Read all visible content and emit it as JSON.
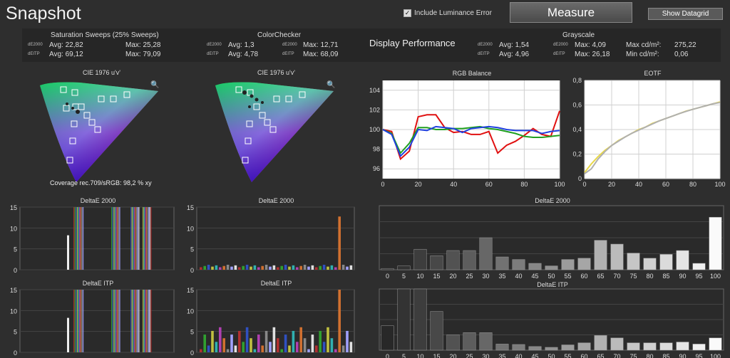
{
  "header": {
    "title": "Snapshot",
    "lum_label": "Include Luminance Error",
    "measure_label": "Measure",
    "datagrid_label": "Show Datagrid"
  },
  "stats": {
    "sat": {
      "title": "Saturation Sweeps (25% Sweeps)",
      "l1": "dE2000",
      "l2": "dEITP",
      "avg1": "Avg: 22,82",
      "max1": "Max: 25,28",
      "avg2": "Avg: 69,12",
      "max2": "Max: 79,09"
    },
    "cc": {
      "title": "ColorChecker",
      "l1": "dE2000",
      "l2": "dEITP",
      "avg1": "Avg: 1,3",
      "max1": "Max: 12,71",
      "avg2": "Avg: 4,78",
      "max2": "Max: 68,09"
    },
    "dp": "Display Performance",
    "gs": {
      "title": "Grayscale",
      "l1": "dE2000",
      "l2": "dEITP",
      "avg1": "Avg: 1,54",
      "max1": "Max: 4,09",
      "avg2": "Avg: 4,96",
      "max2": "Max: 26,18",
      "cdmax_label": "Max cd/m²:",
      "cdmax": "275,22",
      "cdmin_label": "Min cd/m²:",
      "cdmin": "0,06"
    }
  },
  "cie": {
    "title": "CIE 1976 u'v'",
    "coverage": "Coverage rec.709/sRGB:  98,2 % xy"
  },
  "chart_data": [
    {
      "type": "line",
      "title": "RGB Balance",
      "x": [
        0,
        5,
        10,
        15,
        20,
        25,
        30,
        35,
        40,
        45,
        50,
        55,
        60,
        65,
        70,
        75,
        80,
        85,
        90,
        95,
        100
      ],
      "ylim": [
        95,
        105
      ],
      "xticks": [
        0,
        20,
        40,
        60,
        80,
        100
      ],
      "yticks": [
        96,
        98,
        100,
        102,
        104
      ],
      "series": [
        {
          "color": "#e01010",
          "values": [
            100,
            99.8,
            97,
            97.8,
            101.3,
            101.5,
            101.5,
            100.2,
            99.7,
            99.8,
            99.5,
            99.5,
            99.8,
            97.6,
            98.4,
            98.8,
            99.4,
            100.1,
            99.5,
            99.3,
            101.9
          ]
        },
        {
          "color": "#20a020",
          "values": [
            100,
            99.6,
            97.6,
            98.6,
            100.2,
            100.2,
            100,
            100,
            100.1,
            100.1,
            100.2,
            100.3,
            100.1,
            100,
            99.8,
            99.6,
            99.3,
            99.2,
            99.2,
            99.3,
            99.4
          ]
        },
        {
          "color": "#2040e0",
          "values": [
            100,
            99.5,
            97.3,
            98.2,
            100,
            99.9,
            100.3,
            100.2,
            100.1,
            99.7,
            100.1,
            100.2,
            100.3,
            100.2,
            100,
            99.9,
            99.9,
            99.9,
            99.6,
            99.8,
            99.9
          ]
        }
      ]
    },
    {
      "type": "line",
      "title": "EOTF",
      "x": [
        0,
        5,
        10,
        15,
        20,
        25,
        30,
        35,
        40,
        45,
        50,
        55,
        60,
        65,
        70,
        75,
        80,
        85,
        90,
        95,
        100
      ],
      "ylim": [
        0,
        0.8
      ],
      "xticks": [
        0,
        20,
        40,
        60,
        80,
        100
      ],
      "yticks": [
        0,
        0.2,
        0.4,
        0.6,
        0.8
      ],
      "ytick_labels": [
        "0",
        "0,2",
        "0,4",
        "0,6",
        "0,8"
      ],
      "series": [
        {
          "color": "#e8d84a",
          "values": [
            0.05,
            0.12,
            0.18,
            0.23,
            0.27,
            0.31,
            0.34,
            0.37,
            0.4,
            0.42,
            0.45,
            0.47,
            0.49,
            0.51,
            0.53,
            0.55,
            0.565,
            0.58,
            0.595,
            0.61,
            0.625
          ]
        },
        {
          "color": "#b0b0b0",
          "values": [
            0.04,
            0.08,
            0.16,
            0.22,
            0.27,
            0.305,
            0.34,
            0.37,
            0.395,
            0.42,
            0.445,
            0.47,
            0.49,
            0.51,
            0.53,
            0.548,
            0.565,
            0.58,
            0.595,
            0.61,
            0.62
          ]
        }
      ]
    },
    {
      "type": "bar",
      "title": "DeltaE 2000",
      "categories": [
        "0",
        "5",
        "10",
        "15",
        "20",
        "25",
        "30",
        "35",
        "40",
        "45",
        "50",
        "55",
        "60",
        "65",
        "70",
        "75",
        "80",
        "85",
        "90",
        "95",
        "100"
      ],
      "ylim": [
        0,
        5
      ],
      "values": [
        0.1,
        0.3,
        1.6,
        1.1,
        1.5,
        1.5,
        2.5,
        1.0,
        0.8,
        0.5,
        0.3,
        0.8,
        0.9,
        2.3,
        2.0,
        1.3,
        0.9,
        1.2,
        1.5,
        0.5,
        4.1
      ]
    },
    {
      "type": "bar",
      "title": "DeltaE ITP",
      "categories": [
        "0",
        "5",
        "10",
        "15",
        "20",
        "25",
        "30",
        "35",
        "40",
        "45",
        "50",
        "55",
        "60",
        "65",
        "70",
        "75",
        "80",
        "85",
        "90",
        "95",
        "100"
      ],
      "ylim": [
        0,
        15
      ],
      "values": [
        6,
        26,
        25,
        9.5,
        3.8,
        4.3,
        4.3,
        1.5,
        1.4,
        0.9,
        0.7,
        1.3,
        1.8,
        3.6,
        3.0,
        1.8,
        1.8,
        1.8,
        2.0,
        1.5,
        3.0
      ]
    }
  ],
  "mini": {
    "sat2000": {
      "title": "DeltaE 2000",
      "yticks": [
        "15",
        "10",
        "5",
        "0"
      ]
    },
    "satitp": {
      "title": "DeltaE ITP",
      "yticks": [
        "15",
        "10",
        "5",
        "0"
      ]
    },
    "cc2000": {
      "title": "DeltaE 2000",
      "yticks": [
        "15",
        "10",
        "5",
        "0"
      ]
    },
    "ccitp": {
      "title": "DeltaE ITP",
      "yticks": [
        "15",
        "10",
        "5",
        "0"
      ]
    }
  },
  "icons": {
    "checkbox": "check-icon",
    "magnifier": "search-icon"
  }
}
